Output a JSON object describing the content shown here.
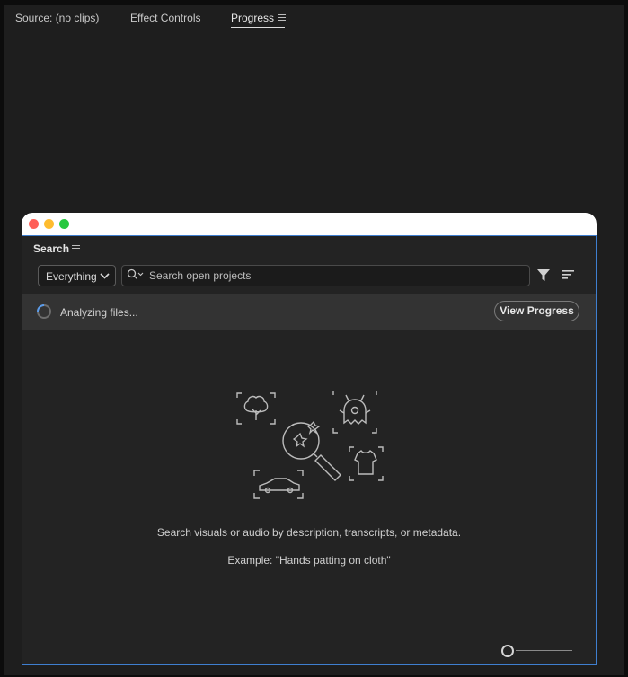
{
  "app": {
    "tabs": [
      {
        "label": "Source: (no clips)"
      },
      {
        "label": "Effect Controls"
      },
      {
        "label": "Progress",
        "active": true
      }
    ]
  },
  "window": {
    "panel_title": "Search",
    "scope_dropdown": {
      "selected": "Everything"
    },
    "search": {
      "placeholder": "Search open projects",
      "value": ""
    },
    "progress": {
      "status_text": "Analyzing files...",
      "button_label": "View Progress"
    },
    "empty_state": {
      "description": "Search visuals or audio by description, transcripts, or metadata.",
      "example": "Example: \"Hands patting on cloth\""
    },
    "icons": [
      "menu-icon",
      "chevron-down-icon",
      "search-icon",
      "filter-icon",
      "sort-icon",
      "spinner-icon",
      "visual-search-illustration"
    ]
  },
  "colors": {
    "panel_border": "#3f7fd0",
    "close": "#fe5f57",
    "minimize": "#febc2e",
    "zoom": "#28c840"
  }
}
